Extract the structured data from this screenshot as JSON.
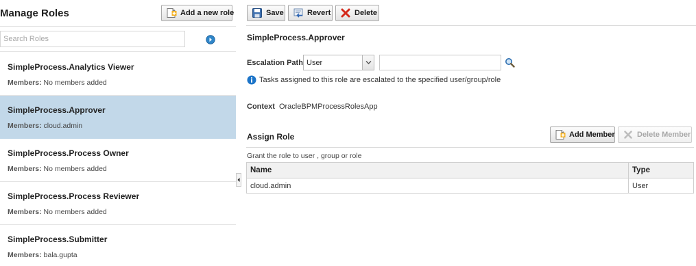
{
  "left": {
    "title": "Manage Roles",
    "add_role_label": "Add a new role",
    "search_placeholder": "Search Roles",
    "members_label": "Members:",
    "roles": [
      {
        "name": "SimpleProcess.Analytics Viewer",
        "members": "No members added"
      },
      {
        "name": "SimpleProcess.Approver",
        "members": "cloud.admin",
        "selected": true
      },
      {
        "name": "SimpleProcess.Process Owner",
        "members": "No members added"
      },
      {
        "name": "SimpleProcess.Process Reviewer",
        "members": "No members added"
      },
      {
        "name": "SimpleProcess.Submitter",
        "members": "bala.gupta"
      }
    ]
  },
  "toolbar": {
    "save_label": "Save",
    "revert_label": "Revert",
    "delete_label": "Delete"
  },
  "detail": {
    "role_title": "SimpleProcess.Approver",
    "escalation_label": "Escalation Path",
    "escalation_value": "User",
    "escalation_input_value": "",
    "info_text": "Tasks assigned to this role are escalated to the specified user/group/role",
    "context_label": "Context",
    "context_value": "OracleBPMProcessRolesApp"
  },
  "assign": {
    "title": "Assign Role",
    "add_member_label": "Add Member",
    "delete_member_label": "Delete Member",
    "grant_text": "Grant the role to user , group or role",
    "columns": {
      "name": "Name",
      "type": "Type"
    },
    "rows": [
      {
        "name": "cloud.admin",
        "type": "User"
      }
    ]
  },
  "colors": {
    "selected_row": "#c2d8e9",
    "info_blue": "#1c74c8",
    "delete_red": "#d42a1c"
  }
}
